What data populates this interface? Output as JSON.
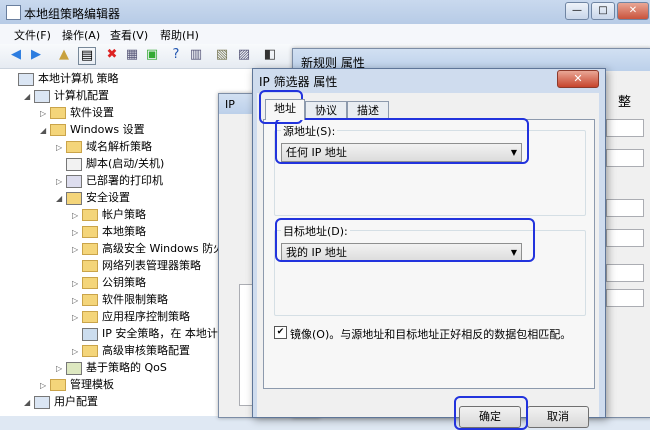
{
  "window": {
    "title": "本地组策略编辑器",
    "min": "—",
    "max": "□",
    "close": "✕"
  },
  "menu": [
    "文件(F)",
    "操作(A)",
    "查看(V)",
    "帮助(H)"
  ],
  "tree": [
    {
      "label": "本地计算机 策略",
      "indent": 0,
      "expand": "",
      "icon": "computer"
    },
    {
      "label": "计算机配置",
      "indent": 1,
      "expand": "◢",
      "icon": "config"
    },
    {
      "label": "软件设置",
      "indent": 2,
      "expand": "▷",
      "icon": "folder"
    },
    {
      "label": "Windows 设置",
      "indent": 2,
      "expand": "◢",
      "icon": "folder"
    },
    {
      "label": "域名解析策略",
      "indent": 3,
      "expand": "▷",
      "icon": "folder"
    },
    {
      "label": "脚本(启动/关机)",
      "indent": 3,
      "expand": "",
      "icon": "script"
    },
    {
      "label": "已部署的打印机",
      "indent": 3,
      "expand": "▷",
      "icon": "printer"
    },
    {
      "label": "安全设置",
      "indent": 3,
      "expand": "◢",
      "icon": "security"
    },
    {
      "label": "帐户策略",
      "indent": 4,
      "expand": "▷",
      "icon": "folder"
    },
    {
      "label": "本地策略",
      "indent": 4,
      "expand": "▷",
      "icon": "folder"
    },
    {
      "label": "高级安全 Windows 防火墙",
      "indent": 4,
      "expand": "▷",
      "icon": "folder"
    },
    {
      "label": "网络列表管理器策略",
      "indent": 4,
      "expand": "",
      "icon": "folder"
    },
    {
      "label": "公钥策略",
      "indent": 4,
      "expand": "▷",
      "icon": "folder"
    },
    {
      "label": "软件限制策略",
      "indent": 4,
      "expand": "▷",
      "icon": "folder"
    },
    {
      "label": "应用程序控制策略",
      "indent": 4,
      "expand": "▷",
      "icon": "folder"
    },
    {
      "label": "IP 安全策略，在 本地计算机",
      "indent": 4,
      "expand": "",
      "icon": "ipsec"
    },
    {
      "label": "高级审核策略配置",
      "indent": 4,
      "expand": "▷",
      "icon": "folder"
    },
    {
      "label": "基于策略的 QoS",
      "indent": 3,
      "expand": "▷",
      "icon": "qos"
    },
    {
      "label": "管理模板",
      "indent": 2,
      "expand": "▷",
      "icon": "folder"
    },
    {
      "label": "用户配置",
      "indent": 1,
      "expand": "◢",
      "icon": "config"
    }
  ],
  "rule_dialog": {
    "title": "新规则 属性",
    "close": "✕",
    "ok_tail": "整"
  },
  "ip_dialog_bg": {
    "title": "IP"
  },
  "filter_dialog": {
    "title": "IP 筛选器 属性",
    "close": "✕",
    "tabs": [
      "地址",
      "协议",
      "描述"
    ],
    "source_label": "源地址(S):",
    "source_value": "任何 IP 地址",
    "dest_label": "目标地址(D):",
    "dest_value": "我的 IP 地址",
    "mirror_label": "镜像(O)。与源地址和目标地址正好相反的数据包相匹配。",
    "mirror_checked": "✔",
    "ok": "确定",
    "cancel": "取消"
  }
}
